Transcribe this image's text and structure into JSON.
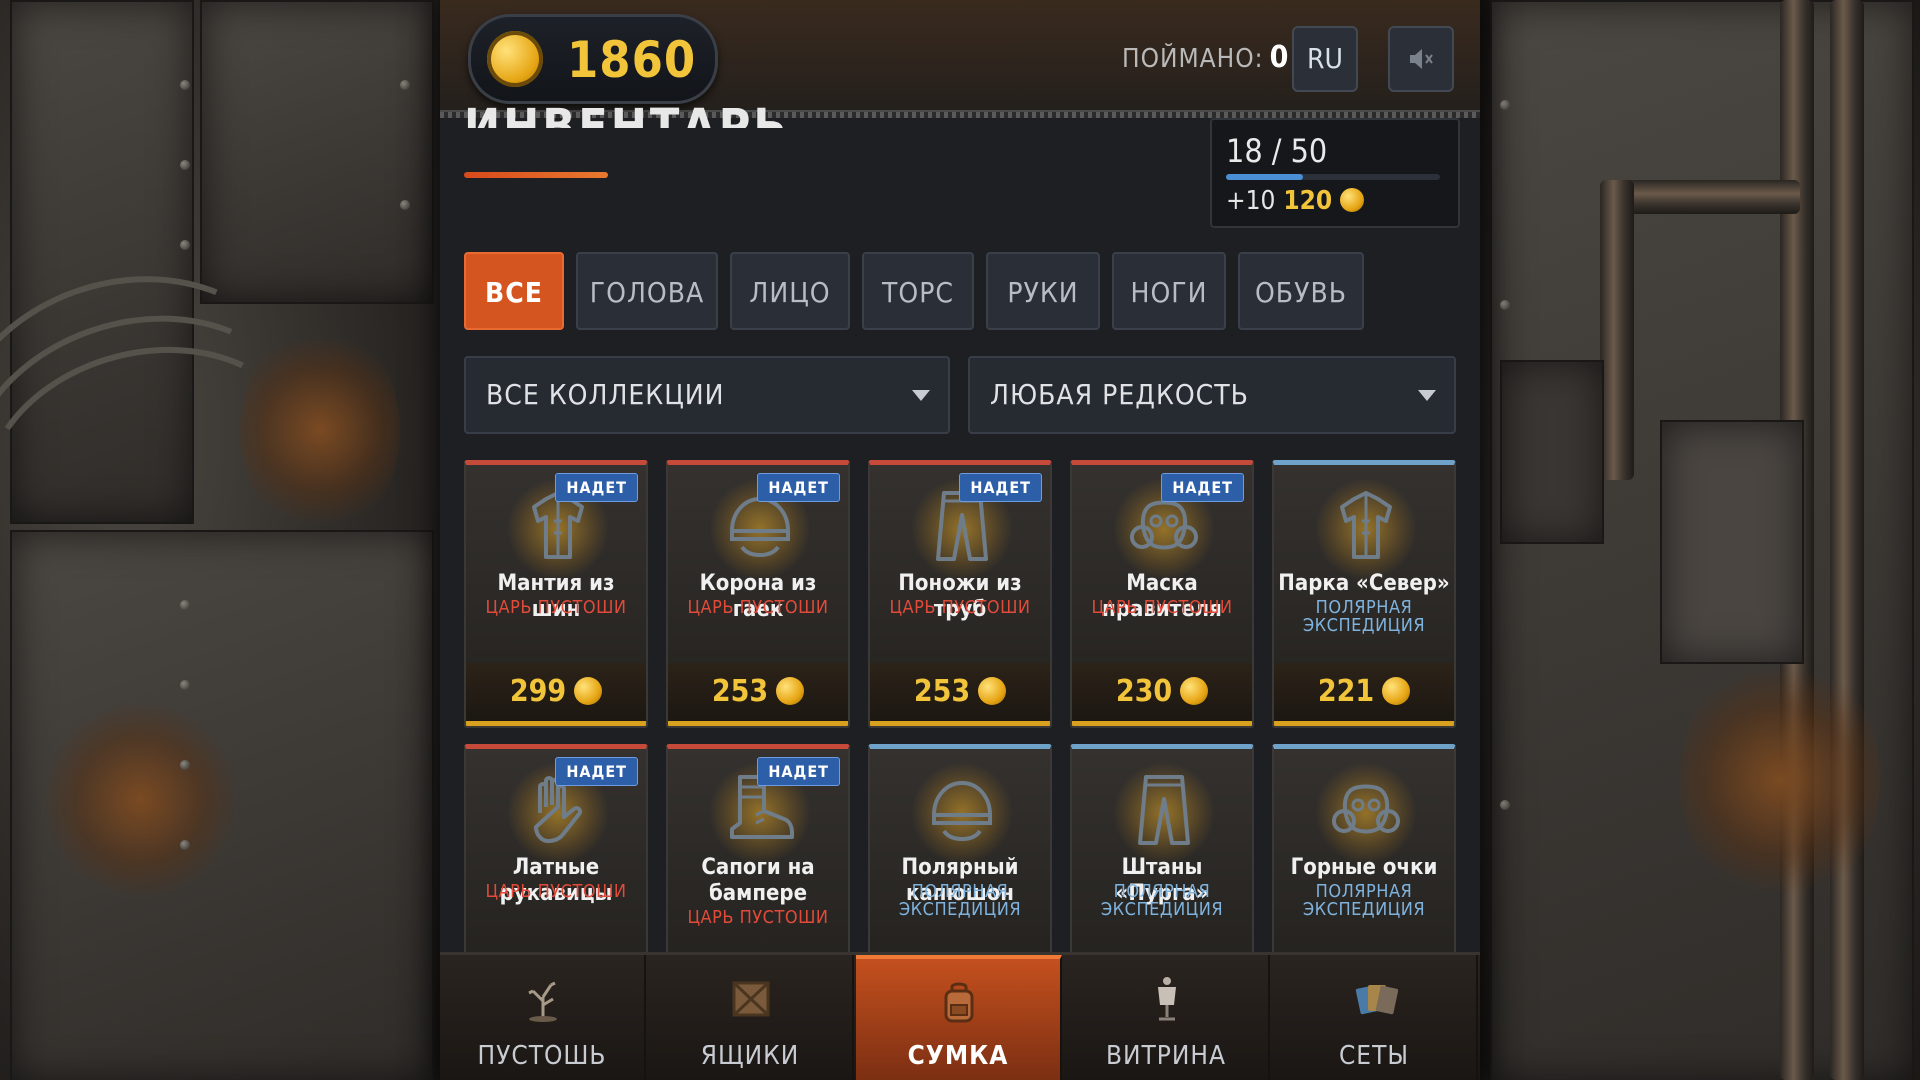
{
  "header": {
    "coins": "1860",
    "caught_label": "ПОЙМАНО:",
    "caught_value": "0",
    "lang": "RU",
    "sound_icon": "speaker-muted-icon"
  },
  "page": {
    "title": "ИНВЕНТАРЬ",
    "capacity": "18 / 50",
    "capacity_fraction": 0.36,
    "reward_prefix": "+10",
    "reward_value": "120"
  },
  "tabs": [
    {
      "label": "ВСЕ",
      "active": true
    },
    {
      "label": "ГОЛОВА",
      "active": false
    },
    {
      "label": "ЛИЦО",
      "active": false
    },
    {
      "label": "ТОРС",
      "active": false
    },
    {
      "label": "РУКИ",
      "active": false
    },
    {
      "label": "НОГИ",
      "active": false
    },
    {
      "label": "ОБУВЬ",
      "active": false
    }
  ],
  "filters": {
    "collection": "ВСЕ КОЛЛЕКЦИИ",
    "rarity": "ЛЮБАЯ РЕДКОСТЬ"
  },
  "items": [
    {
      "name": "Мантия из шин",
      "collection": "ЦАРЬ ПУСТОШИ",
      "tier": "red",
      "badge": "НАДЕТ",
      "price": "299",
      "icon": "jacket-icon"
    },
    {
      "name": "Корона из гаек",
      "collection": "ЦАРЬ ПУСТОШИ",
      "tier": "red",
      "badge": "НАДЕТ",
      "price": "253",
      "icon": "helmet-icon"
    },
    {
      "name": "Поножи из труб",
      "collection": "ЦАРЬ ПУСТОШИ",
      "tier": "red",
      "badge": "НАДЕТ",
      "price": "253",
      "icon": "pants-icon"
    },
    {
      "name": "Маска правителя",
      "collection": "ЦАРЬ ПУСТОШИ",
      "tier": "red",
      "badge": "НАДЕТ",
      "price": "230",
      "icon": "gasmask-icon"
    },
    {
      "name": "Парка «Север»",
      "collection": "ПОЛЯРНАЯ ЭКСПЕДИЦИЯ",
      "tier": "blue",
      "badge": "",
      "price": "221",
      "icon": "jacket-icon"
    },
    {
      "name": "Латные рукавицы",
      "collection": "ЦАРЬ ПУСТОШИ",
      "tier": "red",
      "badge": "НАДЕТ",
      "price": "",
      "icon": "glove-icon"
    },
    {
      "name": "Сапоги на бампере",
      "collection": "ЦАРЬ ПУСТОШИ",
      "tier": "red",
      "badge": "НАДЕТ",
      "price": "",
      "icon": "boot-icon"
    },
    {
      "name": "Полярный капюшон",
      "collection": "ПОЛЯРНАЯ ЭКСПЕДИЦИЯ",
      "tier": "blue",
      "badge": "",
      "price": "",
      "icon": "helmet-icon"
    },
    {
      "name": "Штаны «Пурга»",
      "collection": "ПОЛЯРНАЯ ЭКСПЕДИЦИЯ",
      "tier": "blue",
      "badge": "",
      "price": "",
      "icon": "pants-icon"
    },
    {
      "name": "Горные очки",
      "collection": "ПОЛЯРНАЯ ЭКСПЕДИЦИЯ",
      "tier": "blue",
      "badge": "",
      "price": "",
      "icon": "gasmask-icon"
    }
  ],
  "nav": [
    {
      "label": "ПУСТОШЬ",
      "icon": "dead-tree-icon",
      "active": false
    },
    {
      "label": "ЯЩИКИ",
      "icon": "crate-icon",
      "active": false
    },
    {
      "label": "СУМКА",
      "icon": "backpack-icon",
      "active": true
    },
    {
      "label": "ВИТРИНА",
      "icon": "mannequin-icon",
      "active": false
    },
    {
      "label": "СЕТЫ",
      "icon": "cards-icon",
      "active": false
    }
  ],
  "colors": {
    "accent": "#d4551f",
    "gold": "#f2c43a",
    "rare_red": "#e24a3a",
    "rare_blue": "#7fb3de",
    "equipped_badge": "#2d5fa8"
  }
}
